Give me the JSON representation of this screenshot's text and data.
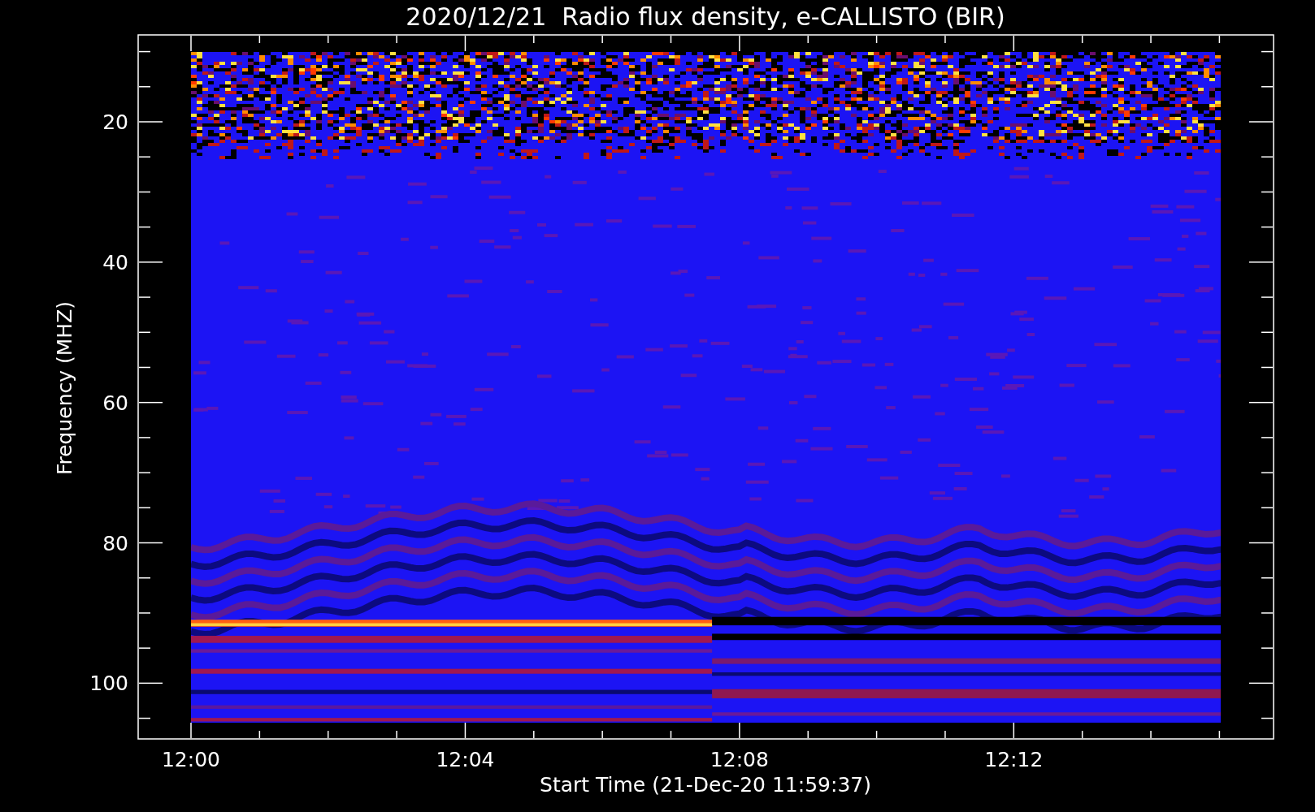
{
  "title": "2020/12/21  Radio flux density, e-CALLISTO (BIR)",
  "y_axis": {
    "label": "Frequency (MHZ)",
    "ticks": [
      "20",
      "40",
      "60",
      "80",
      "100"
    ]
  },
  "x_axis": {
    "label": "Start Time (21-Dec-20 11:59:37)",
    "ticks": [
      "12:00",
      "12:04",
      "12:08",
      "12:12"
    ]
  }
}
